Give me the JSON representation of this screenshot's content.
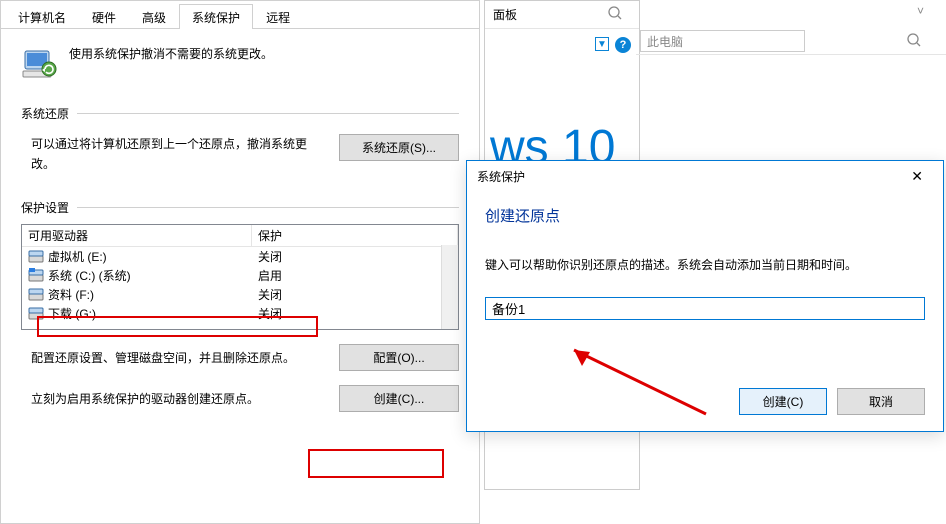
{
  "bg": {
    "panel_label": "面板",
    "brand": "ws 10",
    "explorer_placeholder": "此电脑"
  },
  "tabs": {
    "computer_name": "计算机名",
    "hardware": "硬件",
    "advanced": "高级",
    "system_protection": "系统保护",
    "remote": "远程"
  },
  "intro_text": "使用系统保护撤消不需要的系统更改。",
  "section_restore": "系统还原",
  "restore_desc": "可以通过将计算机还原到上一个还原点，撤消系统更改。",
  "restore_btn": "系统还原(S)...",
  "section_settings": "保护设置",
  "table": {
    "col_drive": "可用驱动器",
    "col_protect": "保护",
    "rows": [
      {
        "name": "虚拟机 (E:)",
        "status": "关闭",
        "icon": "hdd"
      },
      {
        "name": "系统 (C:) (系统)",
        "status": "启用",
        "icon": "hdd-sys"
      },
      {
        "name": "资料 (F:)",
        "status": "关闭",
        "icon": "hdd"
      },
      {
        "name": "下载 (G:)",
        "status": "关闭",
        "icon": "hdd"
      }
    ]
  },
  "config_desc": "配置还原设置、管理磁盘空间，并且删除还原点。",
  "config_btn": "配置(O)...",
  "create_desc": "立刻为启用系统保护的驱动器创建还原点。",
  "create_btn": "创建(C)...",
  "modal": {
    "title": "系统保护",
    "heading": "创建还原点",
    "desc": "键入可以帮助你识别还原点的描述。系统会自动添加当前日期和时间。",
    "input_value": "备份1",
    "ok": "创建(C)",
    "cancel": "取消"
  }
}
